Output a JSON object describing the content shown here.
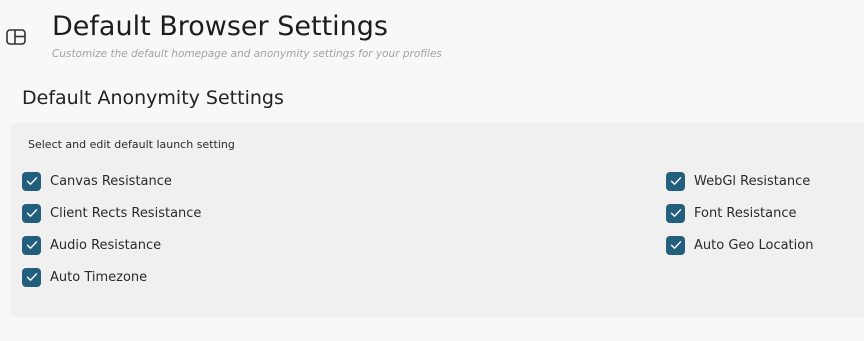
{
  "header": {
    "title": "Default Browser Settings",
    "subtitle": "Customize the default homepage and anonymity settings for your profiles"
  },
  "section": {
    "title": "Default Anonymity Settings",
    "hint": "Select and edit default launch setting"
  },
  "options_left": [
    {
      "label": "Canvas Resistance",
      "checked": true
    },
    {
      "label": "Client Rects Resistance",
      "checked": true
    },
    {
      "label": "Audio Resistance",
      "checked": true
    },
    {
      "label": "Auto Timezone",
      "checked": true
    }
  ],
  "options_right": [
    {
      "label": "WebGl Resistance",
      "checked": true
    },
    {
      "label": "Font Resistance",
      "checked": true
    },
    {
      "label": "Auto Geo Location",
      "checked": true
    }
  ],
  "colors": {
    "checkbox_fill": "#235f7d",
    "page_bg": "#f8f8f8",
    "panel_bg": "#f0f0f0"
  },
  "icons": {
    "sidebar_toggle": "sidebar-panel-icon",
    "checkbox": "checkmark-icon"
  }
}
